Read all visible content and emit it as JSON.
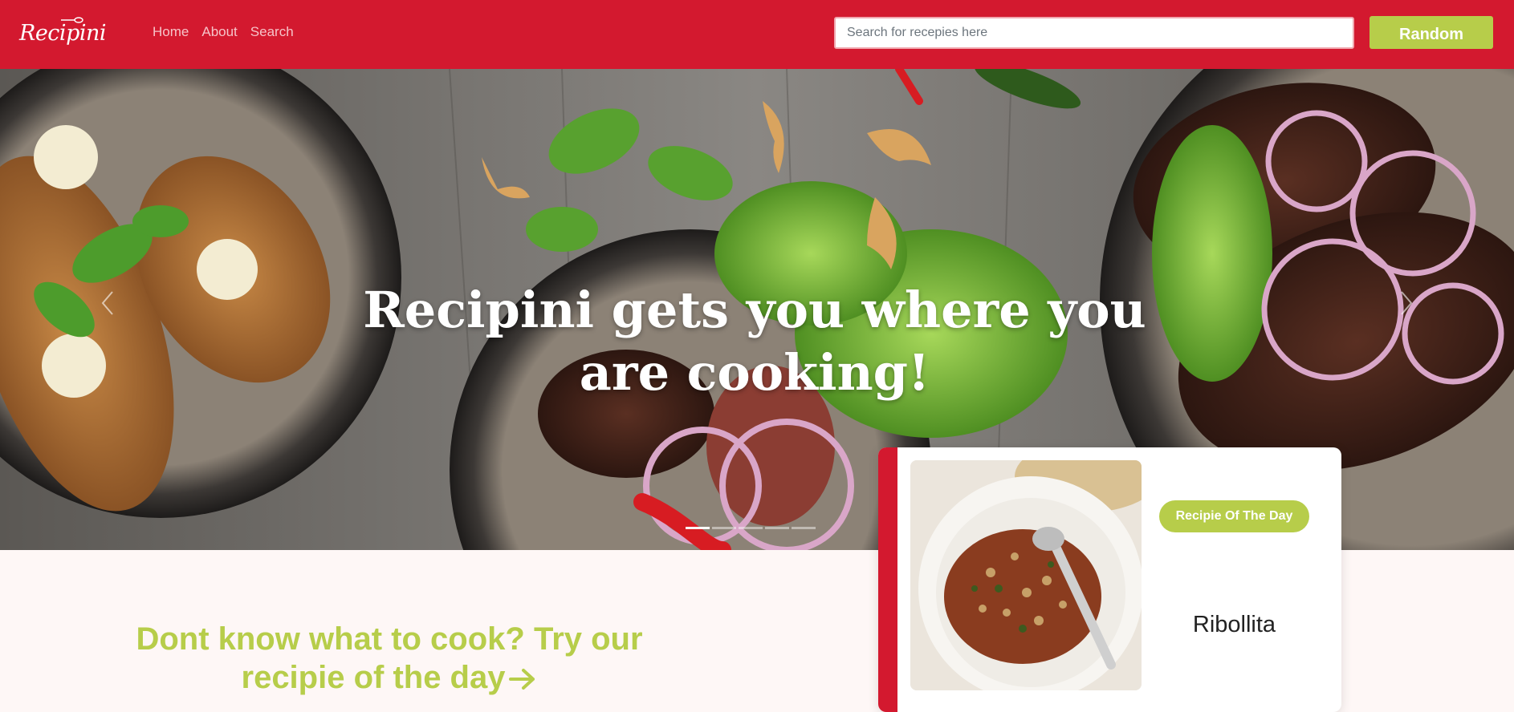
{
  "brand": {
    "logo_text": "Recipini"
  },
  "nav": {
    "home": "Home",
    "about": "About",
    "search": "Search"
  },
  "search": {
    "placeholder": "Search for recepies here"
  },
  "random_button": {
    "label": "Random"
  },
  "hero": {
    "title": "Recipini gets you where you are cooking!",
    "slide_count": 5,
    "active_slide": 1
  },
  "cta": {
    "text": "Dont know what to cook? Try our recipie of the day"
  },
  "recipe_of_day": {
    "badge": "Recipie Of The Day",
    "name": "Ribollita"
  },
  "colors": {
    "brand_red": "#d3192f",
    "accent_green": "#b7cd4a",
    "page_bg": "#fef7f6"
  },
  "icons": {
    "prev": "chevron-left-icon",
    "next": "chevron-right-icon",
    "cta_arrow": "arrow-right-icon"
  }
}
